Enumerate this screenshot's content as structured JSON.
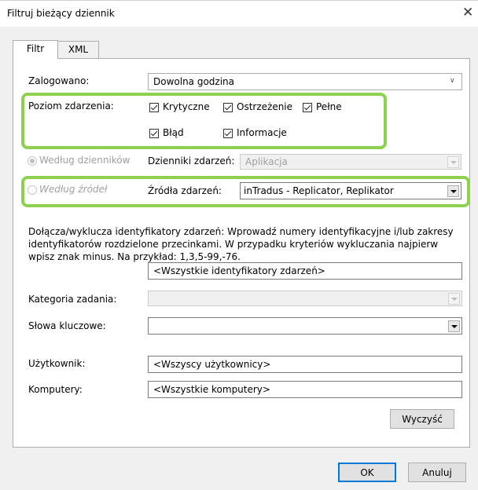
{
  "dialog": {
    "title": "Filtruj bieżący dziennik",
    "close_glyph": "✕"
  },
  "tabs": [
    {
      "label": "Filtr"
    },
    {
      "label": "XML"
    }
  ],
  "logged": {
    "label": "Zalogowano:",
    "value": "Dowolna godzina"
  },
  "event_level": {
    "label": "Poziom zdarzenia:",
    "options": [
      {
        "label": "Krytyczne",
        "checked": true
      },
      {
        "label": "Ostrzeżenie",
        "checked": true
      },
      {
        "label": "Pełne",
        "checked": true
      },
      {
        "label": "Błąd",
        "checked": true
      },
      {
        "label": "Informacje",
        "checked": true
      }
    ]
  },
  "by_log": {
    "radio_label": "Według dzienników",
    "field_label": "Dzienniki zdarzeń:",
    "value": "Aplikacja"
  },
  "by_source": {
    "radio_label": "Według źródeł",
    "field_label": "Źródła zdarzeń:",
    "value": "inTradus - Replicator, Replikator"
  },
  "event_ids": {
    "description": "Dołącza/wyklucza identyfikatory zdarzeń: Wprowadź numery identyfikacyjne i/lub zakresy identyfikatorów rozdzielone przecinkami. W przypadku kryteriów wykluczania najpierw wpisz znak minus. Na przykład: 1,3,5-99,-76.",
    "value": "<Wszystkie identyfikatory zdarzeń>"
  },
  "task_category": {
    "label": "Kategoria zadania:",
    "value": ""
  },
  "keywords": {
    "label": "Słowa kluczowe:",
    "value": ""
  },
  "user": {
    "label": "Użytkownik:",
    "value": "<Wszyscy użytkownicy>"
  },
  "computers": {
    "label": "Komputery:",
    "value": "<Wszystkie komputery>"
  },
  "buttons": {
    "clear": "Wyczyść",
    "ok": "OK",
    "cancel": "Anuluj"
  },
  "colors": {
    "highlight": "#8ed04f",
    "accent": "#0078d7"
  },
  "icons": {
    "close": "close-icon",
    "checkbox": "checkbox-checked-icon",
    "dropdown": "chevron-down-icon"
  }
}
